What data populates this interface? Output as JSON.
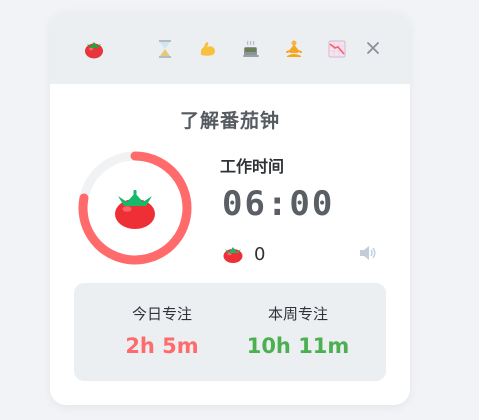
{
  "header": {
    "icons": [
      "tomato-icon",
      "hourglass-icon",
      "flexed-biceps-icon",
      "hot-beverage-icon",
      "meditation-icon",
      "chart-decreasing-icon"
    ],
    "close_label": "×"
  },
  "main": {
    "title": "了解番茄钟",
    "phase_label": "工作时间",
    "timer": "06:00",
    "pomodoro_count": "0",
    "progress_fraction": 0.78
  },
  "stats": {
    "today_label": "今日专注",
    "today_value": "2h 5m",
    "week_label": "本周专注",
    "week_value": "10h 11m"
  },
  "colors": {
    "accent_red": "#ff6b6b",
    "accent_green": "#4caf50",
    "ring_track": "#f1f2f4",
    "panel_bg": "#eceff2"
  }
}
